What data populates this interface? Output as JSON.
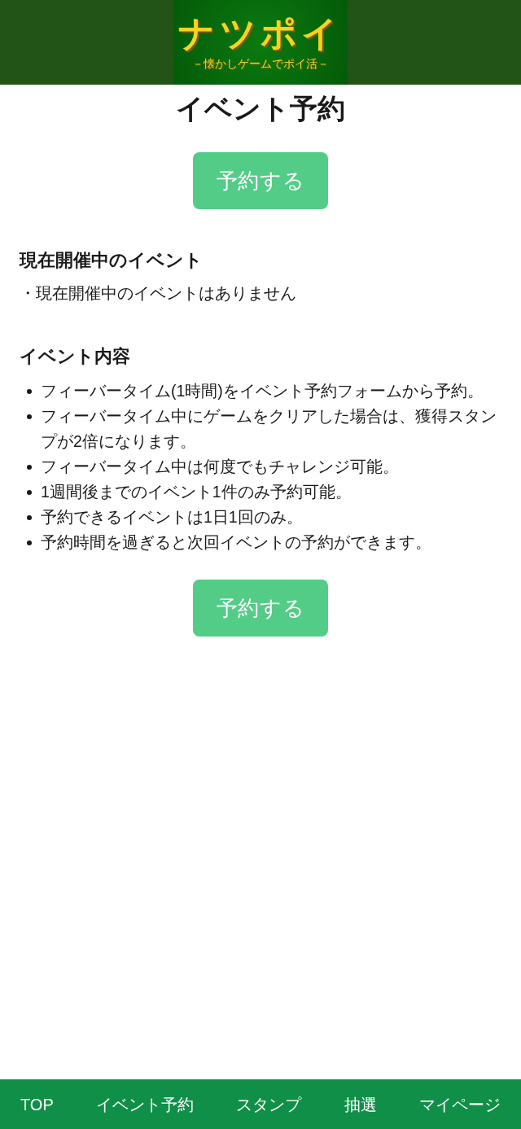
{
  "header": {
    "logo": {
      "title": "ナツポイ",
      "subtitle": "－懐かしゲームでポイ活－"
    }
  },
  "page_title": "イベント予約",
  "reserve_buttons": [
    {
      "label": "予約する"
    },
    {
      "label": "予約する"
    }
  ],
  "current_events": {
    "heading": "現在開催中のイベント",
    "note": "・現在開催中のイベントはありません"
  },
  "event_details": {
    "heading": "イベント内容",
    "items": [
      "フィーバータイム(1時間)をイベント予約フォームから予約。",
      "フィーバータイム中にゲームをクリアした場合は、獲得スタンプが2倍になります。",
      "フィーバータイム中は何度でもチャレンジ可能。",
      "1週間後までのイベント1件のみ予約可能。",
      "予約できるイベントは1日1回のみ。",
      "予約時間を過ぎると次回イベントの予約ができます。"
    ]
  },
  "bottom_nav": [
    {
      "label": "TOP"
    },
    {
      "label": "イベント予約"
    },
    {
      "label": "スタンプ"
    },
    {
      "label": "抽選"
    },
    {
      "label": "マイページ"
    }
  ]
}
